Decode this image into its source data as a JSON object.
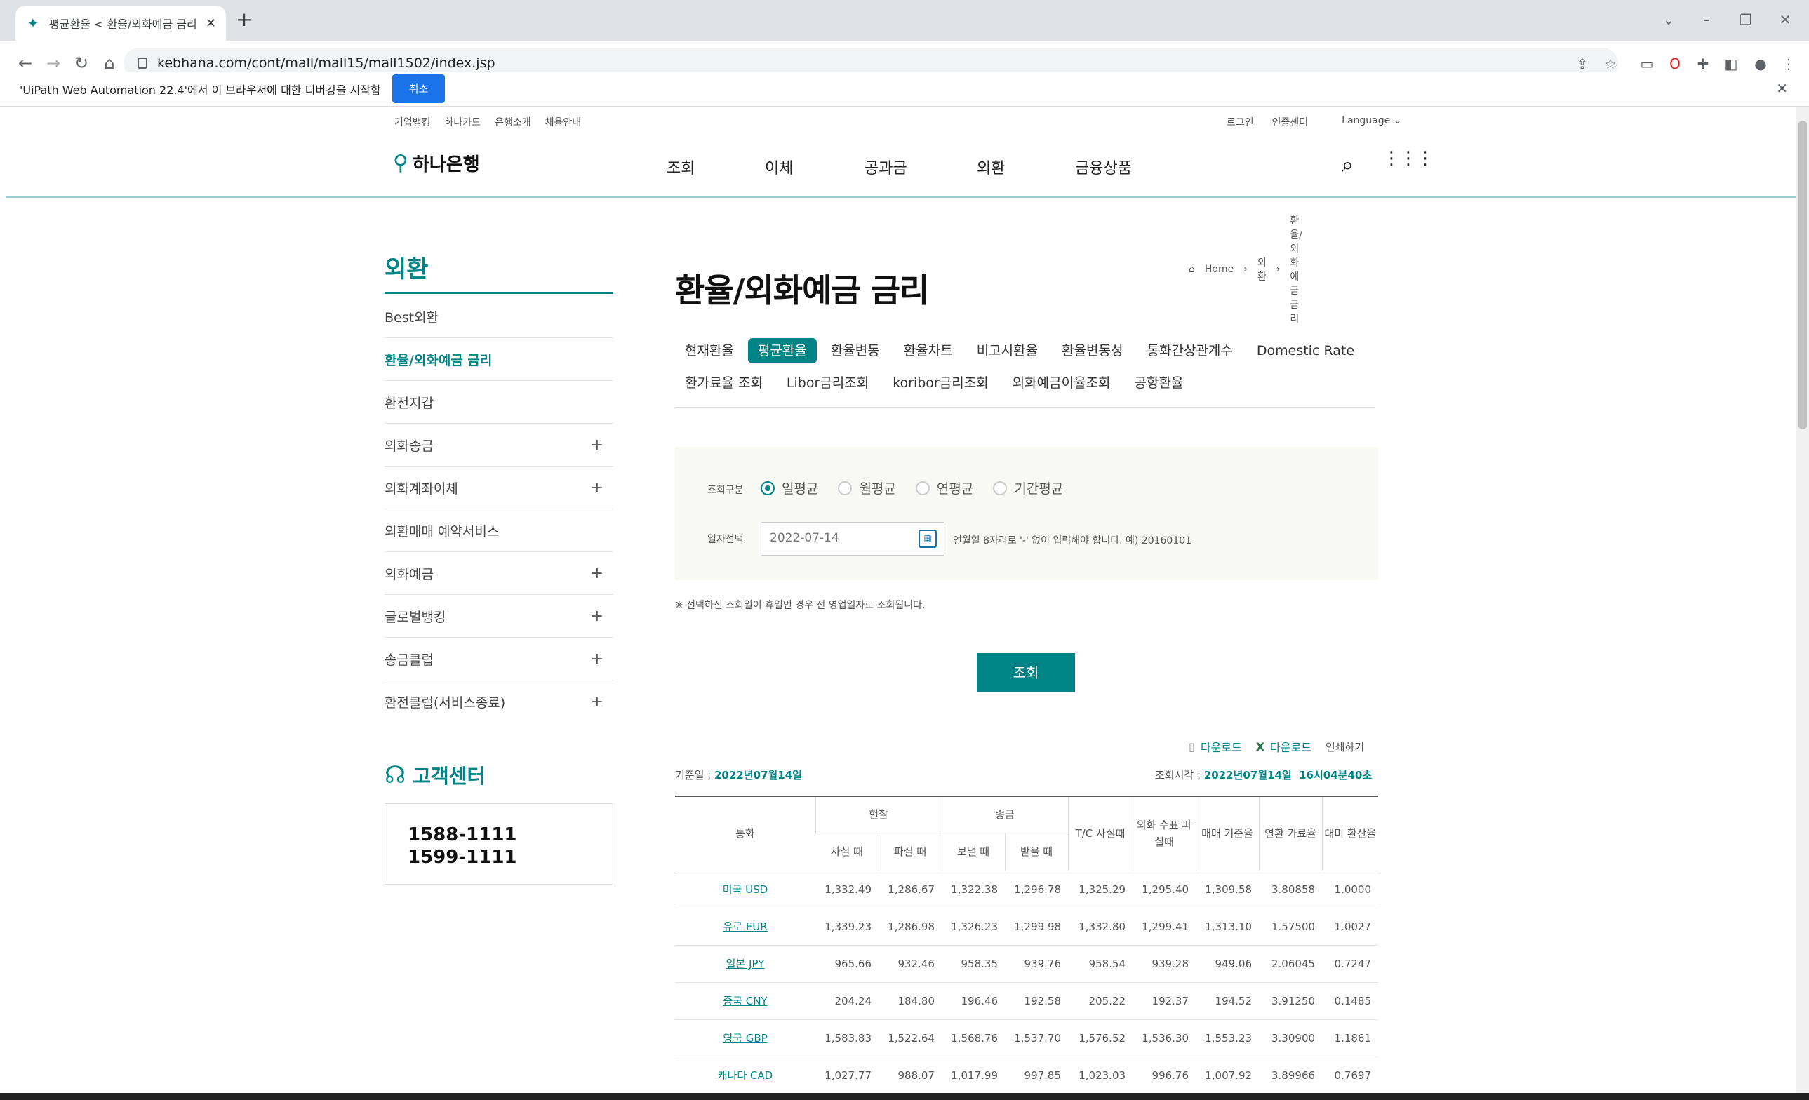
{
  "browser": {
    "tab_title": "평균환율 < 환율/외화예금 금리",
    "url": "kebhana.com/cont/mall/mall15/mall1502/index.jsp",
    "infobar_text": "'UiPath Web Automation 22.4'에서 이 브라우저에 대한 디버깅을 시작함",
    "infobar_button": "취소"
  },
  "utility_nav": [
    "기업뱅킹",
    "하나카드",
    "은행소개",
    "채용안내"
  ],
  "utility_right": [
    "로그인",
    "인증센터",
    "Language"
  ],
  "logo": "하나은행",
  "gnb": [
    "조회",
    "이체",
    "공과금",
    "외환",
    "금융상품"
  ],
  "breadcrumb": [
    "Home",
    "외환",
    "환율/외화예금 금리"
  ],
  "lnb": {
    "title": "외환",
    "items": [
      {
        "label": "Best외환",
        "plus": ""
      },
      {
        "label": "환율/외화예금 금리",
        "plus": ""
      },
      {
        "label": "환전지갑",
        "plus": ""
      },
      {
        "label": "외화송금",
        "plus": "+"
      },
      {
        "label": "외화계좌이체",
        "plus": "+"
      },
      {
        "label": "외환매매 예약서비스",
        "plus": ""
      },
      {
        "label": "외화예금",
        "plus": "+"
      },
      {
        "label": "글로벌뱅킹",
        "plus": "+"
      },
      {
        "label": "송금클럽",
        "plus": "+"
      },
      {
        "label": "환전클럽(서비스종료)",
        "plus": "+"
      }
    ]
  },
  "customer_center": {
    "title": "고객센터",
    "phones": [
      "1588-1111",
      "1599-1111"
    ]
  },
  "page_title": "환율/외화예금 금리",
  "subtabs_row1": [
    "현재환율",
    "평균환율",
    "환율변동",
    "환율차트",
    "비고시환율",
    "환율변동성",
    "통화간상관계수",
    "Domestic Rate"
  ],
  "subtabs_row2": [
    "환가료율 조회",
    "Libor금리조회",
    "koribor금리조회",
    "외화예금이율조회",
    "공항환율"
  ],
  "search": {
    "type_label": "조회구분",
    "options": [
      "일평균",
      "월평균",
      "연평균",
      "기간평균"
    ],
    "date_label": "일자선택",
    "date_value": "2022-07-14",
    "date_hint": "연월일 8자리로 '-' 없이 입력해야 합니다. 예) 20160101",
    "note": "※ 선택하신 조회일이 휴일인 경우 전 영업일자로 조회됩니다.",
    "button": "조회"
  },
  "download": [
    "다운로드",
    "다운로드",
    "인쇄하기"
  ],
  "basis": {
    "label": "기준일 : ",
    "value": "2022년07월14일",
    "time_label": "조회시각 : ",
    "time_value": "2022년07월14일  16시04분40초"
  },
  "table": {
    "h_currency": "통화",
    "h_cash": "현찰",
    "h_transfer": "송금",
    "h_tc": "T/C 사실때",
    "h_check": "외화 수표 파실때",
    "h_base": "매매 기준율",
    "h_conv": "연환 가료율",
    "h_usd": "대미 환산율",
    "h_cash_buy": "사실 때",
    "h_cash_sell": "파실 때",
    "h_send": "보낼 때",
    "h_recv": "받을 때",
    "rows": [
      [
        "미국 USD",
        "1,332.49",
        "1,286.67",
        "1,322.38",
        "1,296.78",
        "1,325.29",
        "1,295.40",
        "1,309.58",
        "3.80858",
        "1.0000"
      ],
      [
        "유로 EUR",
        "1,339.23",
        "1,286.98",
        "1,326.23",
        "1,299.98",
        "1,332.80",
        "1,299.41",
        "1,313.10",
        "1.57500",
        "1.0027"
      ],
      [
        "일본 JPY",
        "965.66",
        "932.46",
        "958.35",
        "939.76",
        "958.54",
        "939.28",
        "949.06",
        "2.06045",
        "0.7247"
      ],
      [
        "중국 CNY",
        "204.24",
        "184.80",
        "196.46",
        "192.58",
        "205.22",
        "192.37",
        "194.52",
        "3.91250",
        "0.1485"
      ],
      [
        "영국 GBP",
        "1,583.83",
        "1,522.64",
        "1,568.76",
        "1,537.70",
        "1,576.52",
        "1,536.30",
        "1,553.23",
        "3.30900",
        "1.1861"
      ],
      [
        "캐나다 CAD",
        "1,027.77",
        "988.07",
        "1,017.99",
        "997.85",
        "1,023.03",
        "996.76",
        "1,007.92",
        "3.89966",
        "0.7697"
      ]
    ]
  }
}
